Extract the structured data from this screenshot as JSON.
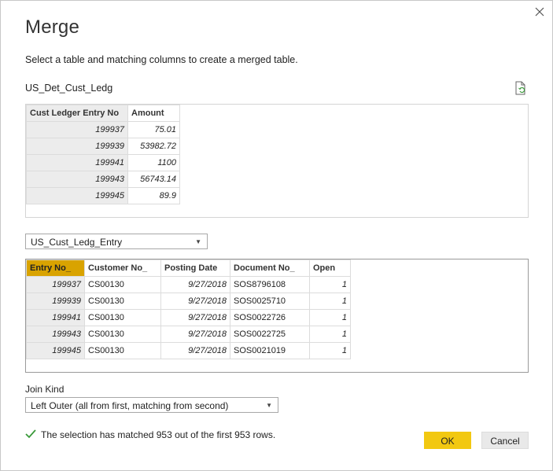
{
  "dialog": {
    "title": "Merge",
    "subtitle": "Select a table and matching columns to create a merged table.",
    "close_icon": "close-icon",
    "refresh_icon": "refresh-file-icon"
  },
  "table1": {
    "name": "US_Det_Cust_Ledg",
    "columns": [
      "Cust Ledger Entry No",
      "Amount"
    ],
    "rows": [
      [
        "199937",
        "75.01"
      ],
      [
        "199939",
        "53982.72"
      ],
      [
        "199941",
        "1100"
      ],
      [
        "199943",
        "56743.14"
      ],
      [
        "199945",
        "89.9"
      ]
    ]
  },
  "table2": {
    "selected_table": "US_Cust_Ledg_Entry",
    "columns": [
      "Entry No_",
      "Customer No_",
      "Posting Date",
      "Document No_",
      "Open"
    ],
    "selected_column": "Entry No_",
    "rows": [
      [
        "199937",
        "CS00130",
        "9/27/2018",
        "SOS8796108",
        "1"
      ],
      [
        "199939",
        "CS00130",
        "9/27/2018",
        "SOS0025710",
        "1"
      ],
      [
        "199941",
        "CS00130",
        "9/27/2018",
        "SOS0022726",
        "1"
      ],
      [
        "199943",
        "CS00130",
        "9/27/2018",
        "SOS0022725",
        "1"
      ],
      [
        "199945",
        "CS00130",
        "9/27/2018",
        "SOS0021019",
        "1"
      ]
    ]
  },
  "join": {
    "label": "Join Kind",
    "value": "Left Outer (all from first, matching from second)"
  },
  "status": {
    "text": "The selection has matched 953 out of the first 953 rows."
  },
  "buttons": {
    "ok": "OK",
    "cancel": "Cancel"
  },
  "colors": {
    "accent": "#f2c811",
    "selected_column": "#d9a300",
    "check": "#3a9a3a"
  }
}
